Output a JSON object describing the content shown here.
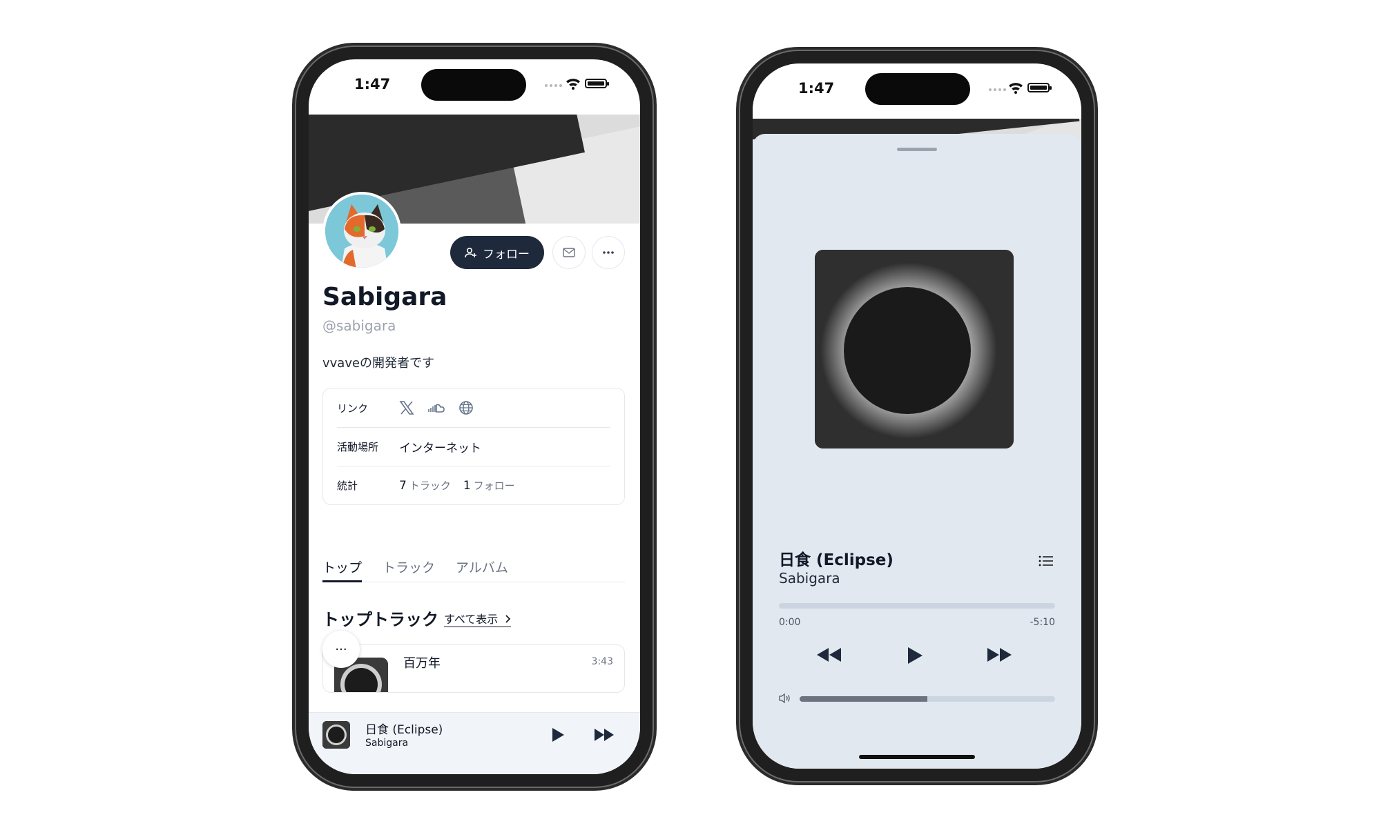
{
  "status_bar": {
    "time": "1:47"
  },
  "profile": {
    "name": "Sabigara",
    "handle": "@sabigara",
    "bio": "vvaveの開発者です",
    "follow_label": "フォロー"
  },
  "info": {
    "links_label": "リンク",
    "location_label": "活動場所",
    "location_value": "インターネット",
    "stats_label": "統計",
    "tracks_count": "7",
    "tracks_label": "トラック",
    "follows_count": "1",
    "follows_label": "フォロー",
    "link_icons": [
      "x-icon",
      "soundcloud-icon",
      "globe-icon"
    ]
  },
  "tabs": [
    {
      "label": "トップ",
      "active": true
    },
    {
      "label": "トラック",
      "active": false
    },
    {
      "label": "アルバム",
      "active": false
    }
  ],
  "top_tracks": {
    "title": "トップトラック",
    "see_all": "すべて表示",
    "items": [
      {
        "name": "百万年",
        "duration": "3:43"
      }
    ]
  },
  "more_label": "···",
  "mini_player": {
    "title": "日食 (Eclipse)",
    "artist": "Sabigara"
  },
  "now_playing": {
    "title": "日食 (Eclipse)",
    "artist": "Sabigara",
    "elapsed": "0:00",
    "remaining": "-5:10",
    "progress": 0,
    "volume": 0.5
  },
  "colors": {
    "primary_button": "#1e293b",
    "sheet_background": "#e2e8f0",
    "muted_text": "#9ca3af"
  }
}
